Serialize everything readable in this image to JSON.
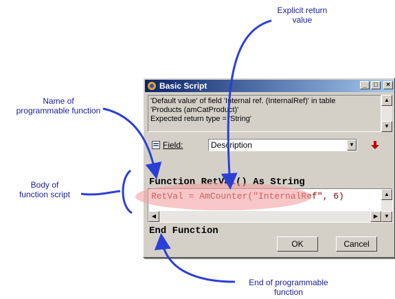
{
  "annotations": {
    "explicit_return": "Explicit return\nvalue",
    "name_function": "Name of\nprogrammable function",
    "body_function": "Body of\nfunction script",
    "end_function": "End of programmable\nfunction"
  },
  "window": {
    "title": "Basic Script",
    "info_lines": [
      "'Default value' of field 'Internal ref. (InternalRef)' in table",
      "'Products (amCatProduct)'",
      "Expected return type = 'String'"
    ],
    "field_label": "Field:",
    "field_value": "Description",
    "code_header": "Function RetVal() As String",
    "code_body": "RetVal = AmCounter(\"InternalRef\", 6)",
    "code_footer": "End Function",
    "ok_label": "OK",
    "cancel_label": "Cancel"
  },
  "colors": {
    "annotation_text": "#1a1a99",
    "arrow": "#2b3fd6",
    "highlight": "#f4a0a0"
  }
}
